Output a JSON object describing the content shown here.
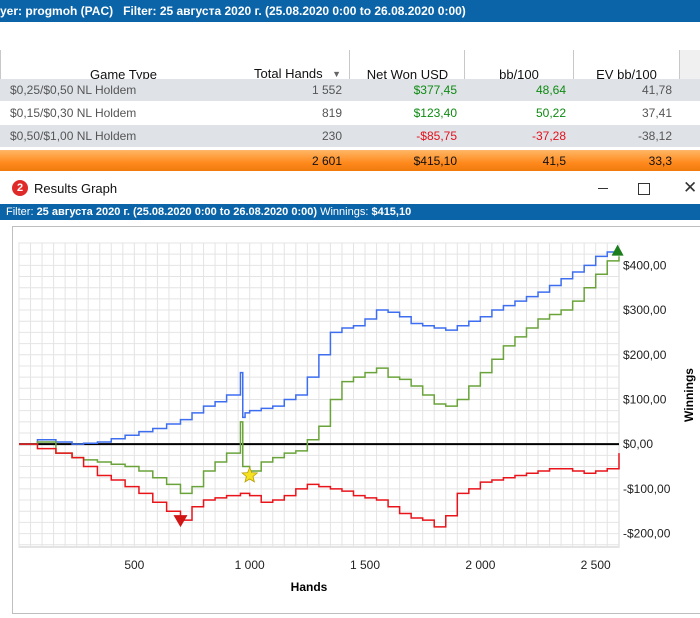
{
  "top_filter_bar": {
    "player_label": "yer:",
    "player_name": "progmoh (PAC)",
    "filter_label": "Filter:",
    "filter_value": "25 августа 2020 г. (25.08.2020 0:00 to 26.08.2020 0:00)"
  },
  "table": {
    "columns": [
      "Game Type",
      "Total Hands",
      "Net Won USD",
      "bb/100",
      "EV bb/100"
    ],
    "rows": [
      {
        "game": "$0,25/$0,50 NL Holdem",
        "hands": "1 552",
        "net": "$377,45",
        "bb": "48,64",
        "ev": "41,78",
        "net_color": "green",
        "bb_color": "green"
      },
      {
        "game": "$0,15/$0,30 NL Holdem",
        "hands": "819",
        "net": "$123,40",
        "bb": "50,22",
        "ev": "37,41",
        "net_color": "green",
        "bb_color": "green"
      },
      {
        "game": "$0,50/$1,00 NL Holdem",
        "hands": "230",
        "net": "-$85,75",
        "bb": "-37,28",
        "ev": "-38,12",
        "net_color": "red",
        "bb_color": "red"
      }
    ],
    "totals": {
      "hands": "2 601",
      "net": "$415,10",
      "bb": "41,5",
      "ev": "33,3"
    }
  },
  "graph_window": {
    "badge": "2",
    "title": "Results Graph",
    "minimize_icon": "minimize-icon",
    "maximize_icon": "maximize-icon",
    "close_icon": "close-icon",
    "filter_label": "Filter:",
    "filter_value": "25 августа 2020 г. (25.08.2020 0:00 to 26.08.2020 0:00)",
    "winnings_label": "Winnings:",
    "winnings_value": "$415,10"
  },
  "colors": {
    "title_bar": "#0b64a8",
    "total_row": "#ff8a1e",
    "positive": "#0e8a12",
    "negative": "#e3101b",
    "line_blue": "#3d6ef0",
    "line_green": "#6aa33a",
    "line_red": "#e8141a"
  },
  "chart_data": {
    "type": "line",
    "xlabel": "Hands",
    "ylabel": "Winnings",
    "xlim": [
      0,
      2601
    ],
    "ylim": [
      -230,
      450
    ],
    "x_ticks": [
      500,
      1000,
      1500,
      2000,
      2500
    ],
    "x_tick_labels": [
      "500",
      "1 000",
      "1 500",
      "2 000",
      "2 500"
    ],
    "y_ticks": [
      400,
      300,
      200,
      100,
      0,
      -100,
      -200
    ],
    "y_tick_labels": [
      "$400,00",
      "$300,00",
      "$200,00",
      "$100,00",
      "$0,00",
      "-$100,00",
      "-$200,00"
    ],
    "grid": true,
    "markers": {
      "max_green_triangle": {
        "x": 2595,
        "y": 433
      },
      "min_red_triangle": {
        "x": 700,
        "y": -170
      },
      "star_yellow": {
        "x": 1000,
        "y": -70
      }
    },
    "series": [
      {
        "key": "blue",
        "values_x": [
          0,
          80,
          160,
          230,
          280,
          340,
          400,
          460,
          520,
          580,
          640,
          700,
          750,
          800,
          850,
          900,
          960,
          970,
          980,
          1000,
          1050,
          1100,
          1150,
          1200,
          1250,
          1300,
          1350,
          1400,
          1450,
          1500,
          1550,
          1600,
          1650,
          1700,
          1750,
          1800,
          1850,
          1900,
          1950,
          2000,
          2050,
          2100,
          2150,
          2200,
          2250,
          2300,
          2350,
          2400,
          2450,
          2500,
          2550,
          2601
        ],
        "values_y": [
          0,
          10,
          5,
          0,
          2,
          5,
          12,
          20,
          28,
          35,
          45,
          55,
          70,
          85,
          95,
          110,
          160,
          60,
          70,
          75,
          80,
          85,
          100,
          110,
          150,
          200,
          250,
          260,
          265,
          280,
          300,
          295,
          285,
          270,
          265,
          260,
          255,
          265,
          275,
          285,
          300,
          310,
          320,
          330,
          340,
          355,
          370,
          385,
          400,
          420,
          430,
          430
        ]
      },
      {
        "key": "green",
        "values_x": [
          0,
          80,
          160,
          230,
          280,
          340,
          400,
          460,
          520,
          580,
          640,
          700,
          750,
          800,
          850,
          900,
          960,
          970,
          1000,
          1050,
          1100,
          1150,
          1200,
          1250,
          1300,
          1350,
          1400,
          1450,
          1500,
          1550,
          1600,
          1650,
          1700,
          1750,
          1800,
          1850,
          1900,
          1950,
          2000,
          2050,
          2100,
          2150,
          2200,
          2250,
          2300,
          2350,
          2400,
          2450,
          2500,
          2550,
          2601
        ],
        "values_y": [
          0,
          5,
          -20,
          -30,
          -35,
          -40,
          -45,
          -50,
          -60,
          -75,
          -90,
          -110,
          -95,
          -60,
          -40,
          -20,
          50,
          -50,
          -60,
          -40,
          -30,
          -20,
          -15,
          10,
          40,
          100,
          140,
          150,
          160,
          170,
          150,
          145,
          130,
          110,
          90,
          85,
          100,
          130,
          160,
          190,
          220,
          240,
          260,
          280,
          290,
          300,
          320,
          350,
          380,
          410,
          420
        ]
      },
      {
        "key": "red",
        "values_x": [
          0,
          80,
          160,
          230,
          280,
          340,
          400,
          460,
          520,
          580,
          640,
          700,
          750,
          800,
          850,
          900,
          960,
          1000,
          1050,
          1100,
          1150,
          1200,
          1250,
          1300,
          1350,
          1400,
          1450,
          1500,
          1550,
          1600,
          1650,
          1700,
          1750,
          1800,
          1850,
          1900,
          1950,
          2000,
          2050,
          2100,
          2150,
          2200,
          2250,
          2300,
          2350,
          2400,
          2450,
          2500,
          2550,
          2601
        ],
        "values_y": [
          0,
          -10,
          -20,
          -30,
          -50,
          -70,
          -80,
          -95,
          -110,
          -130,
          -150,
          -170,
          -140,
          -125,
          -120,
          -115,
          -110,
          -115,
          -130,
          -125,
          -115,
          -100,
          -90,
          -95,
          -100,
          -105,
          -115,
          -120,
          -125,
          -140,
          -155,
          -165,
          -170,
          -185,
          -160,
          -110,
          -100,
          -85,
          -80,
          -75,
          -70,
          -65,
          -60,
          -55,
          -55,
          -60,
          -65,
          -60,
          -55,
          -20
        ]
      }
    ]
  }
}
